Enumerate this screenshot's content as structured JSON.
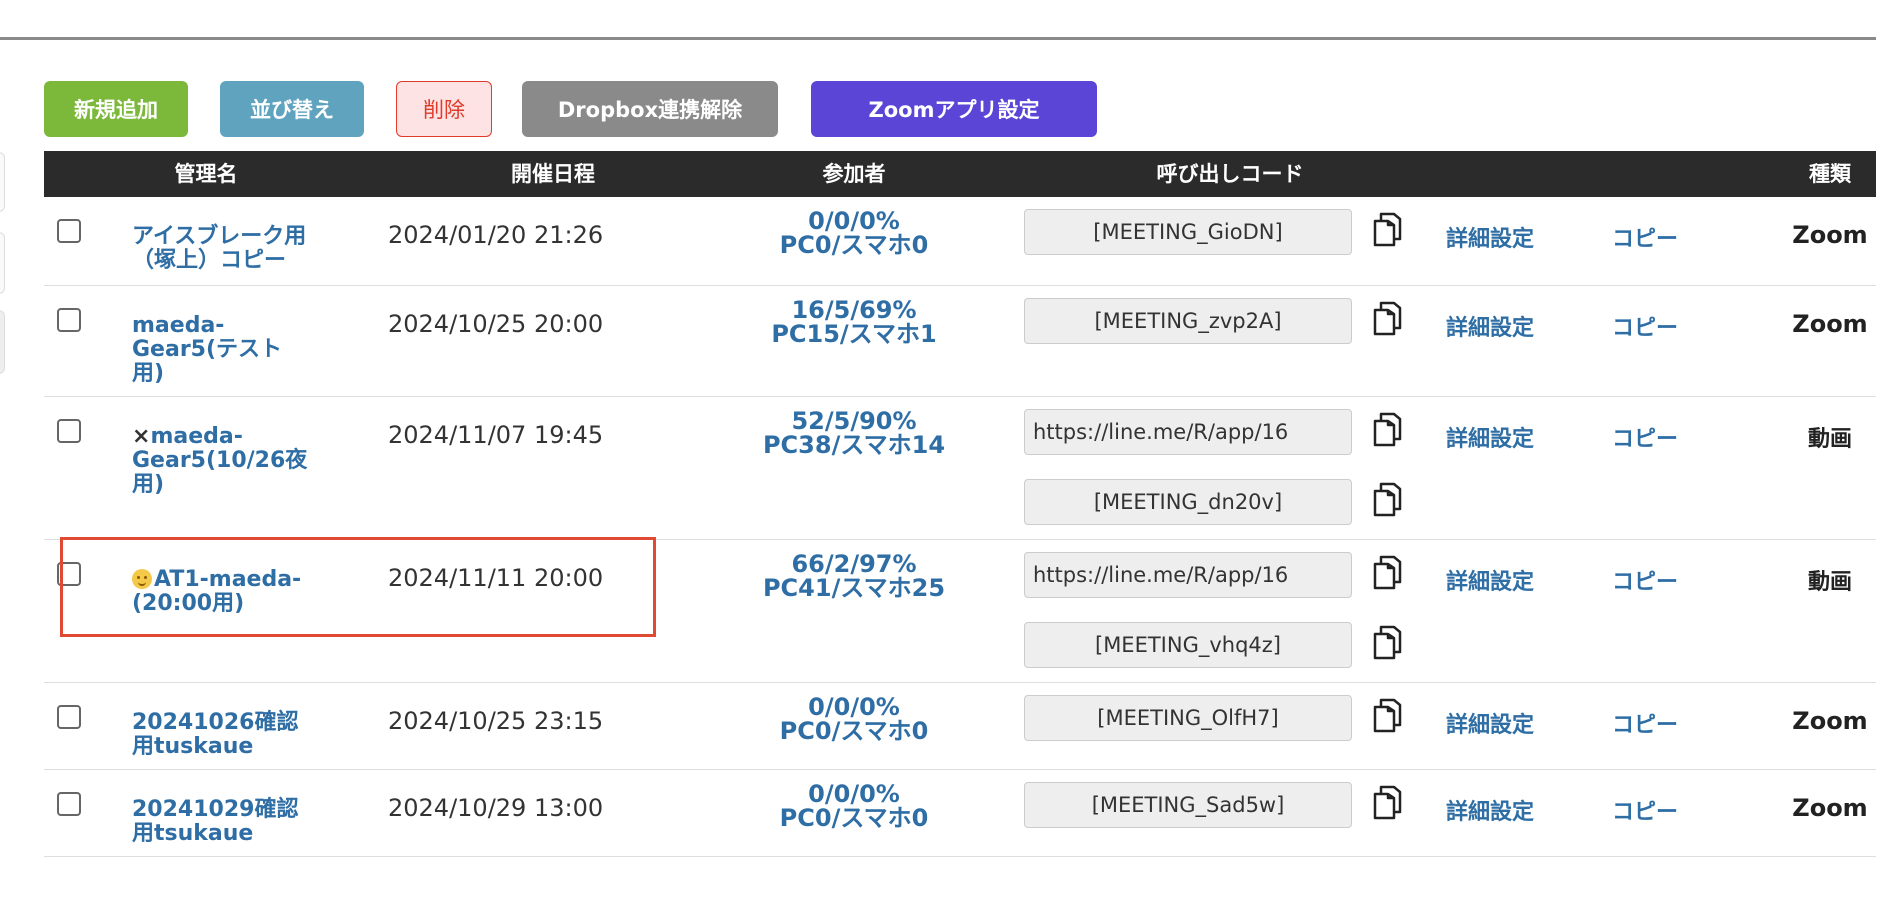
{
  "toolbar": {
    "add_label": "新規追加",
    "sort_label": "並び替え",
    "delete_label": "削除",
    "dropbox_label": "Dropbox連携解除",
    "zoom_label": "Zoomアプリ設定"
  },
  "table": {
    "headers": {
      "name": "管理名",
      "date": "開催日程",
      "participants": "参加者",
      "code": "呼び出しコード",
      "type": "種類"
    },
    "detail_label": "詳細設定",
    "copy_label": "コピー",
    "rows": [
      {
        "name_line1": "アイスブレーク用",
        "name_line2": "（塚上）コピー",
        "name_line3": "",
        "date": "2024/01/20 21:26",
        "part_line1": "0/0/0%",
        "part_line2": "PC0/スマホ0",
        "code1": "[MEETING_GioDN]",
        "code2": "",
        "type": "Zoom"
      },
      {
        "name_line1": "maeda-",
        "name_line2": "Gear5(テスト",
        "name_line3": "用)",
        "date": "2024/10/25 20:00",
        "part_line1": "16/5/69%",
        "part_line2": "PC15/スマホ1",
        "code1": "[MEETING_zvp2A]",
        "code2": "",
        "type": "Zoom"
      },
      {
        "name_mark": "×",
        "name_line1": "maeda-",
        "name_line2": "Gear5(10/26夜",
        "name_line3": "用)",
        "date": "2024/11/07 19:45",
        "part_line1": "52/5/90%",
        "part_line2": "PC38/スマホ14",
        "code1": "https://line.me/R/app/16",
        "code2": "[MEETING_dn20v]",
        "type": "動画"
      },
      {
        "name_line1": "AT1-maeda-",
        "name_line2": "(20:00用)",
        "name_line3": "",
        "date": "2024/11/11 20:00",
        "part_line1": "66/2/97%",
        "part_line2": "PC41/スマホ25",
        "code1": "https://line.me/R/app/16",
        "code2": "[MEETING_vhq4z]",
        "type": "動画"
      },
      {
        "name_line1": "20241026確認",
        "name_line2": "用tuskaue",
        "name_line3": "",
        "date": "2024/10/25 23:15",
        "part_line1": "0/0/0%",
        "part_line2": "PC0/スマホ0",
        "code1": "[MEETING_OlfH7]",
        "code2": "",
        "type": "Zoom"
      },
      {
        "name_line1": "20241029確認",
        "name_line2": "用tsukaue",
        "name_line3": "",
        "date": "2024/10/29 13:00",
        "part_line1": "0/0/0%",
        "part_line2": "PC0/スマホ0",
        "code1": "[MEETING_Sad5w]",
        "code2": "",
        "type": "Zoom"
      }
    ]
  },
  "icons": {
    "copy": "copy-icon",
    "checkbox": "checkbox",
    "emoji": "smiley-icon"
  },
  "colors": {
    "add": "#7cb83a",
    "sort": "#5fa3bf",
    "delete_text": "#e03a2b",
    "dropbox": "#8a8a8a",
    "zoom": "#5b45d6",
    "header_bg": "#2b2b2b",
    "link": "#2f6ea5",
    "highlight": "#e04a35"
  }
}
